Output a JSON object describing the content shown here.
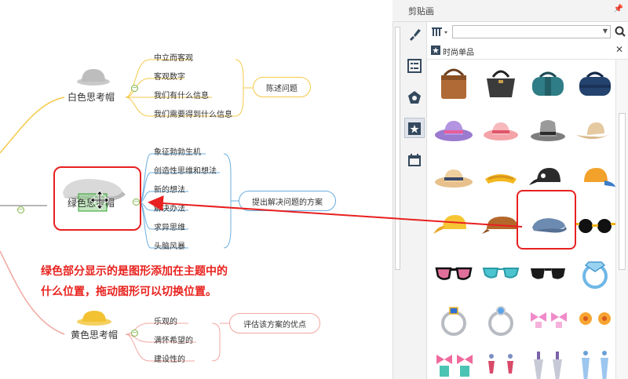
{
  "panel": {
    "title": "剪贴画",
    "pin_icon": "pin-icon",
    "category": "时尚单品",
    "search_placeholder": ""
  },
  "tabs": [
    "brush-icon",
    "list-icon",
    "pentagon-icon",
    "clipart-icon",
    "calendar-icon"
  ],
  "branches": [
    {
      "topic": "白色思考帽",
      "color": "#f5c94a",
      "items": [
        "中立而客观",
        "客观数字",
        "我们有什么信息",
        "我们需要得到什么信息"
      ],
      "summary": "陈述问题"
    },
    {
      "topic": "绿色思考帽",
      "color": "#6aaee0",
      "items": [
        "象征勃勃生机",
        "创造性思维和想法",
        "新的想法",
        "解决办法",
        "求异思维",
        "头脑风暴"
      ],
      "summary": "提出解决问题的方案"
    },
    {
      "topic": "黄色思考帽",
      "color": "#f2a7a0",
      "items": [
        "乐观的",
        "满怀希望的",
        "建设性的"
      ],
      "summary": "评估该方案的优点"
    }
  ],
  "annotation": {
    "line1": "绿色部分显示的是图形添加在主题中的",
    "line2": "什么位置，拖动图形可以切换位置。"
  },
  "clipart": [
    "tote-bag-brown",
    "handbag-black",
    "duffel-bag-teal",
    "duffel-bag-navy",
    "sun-hat-purple",
    "sun-hat-pink",
    "fedora-grey",
    "cowboy-hat-beige",
    "straw-hat",
    "visor-yellow",
    "cap-black",
    "cap-orange-blue",
    "cap-yellow",
    "cap-brown",
    "flat-cap-blue",
    "sunglasses-black",
    "sunglasses-pink",
    "sunglasses-teal",
    "sunglasses-aviator",
    "ring-blue-gem",
    "ring-silver-blue",
    "ring-silver-pink",
    "bow-earrings",
    "flower-earrings",
    "bow-earrings-teal",
    "drop-earrings",
    "chain-earrings",
    "tassel-earrings"
  ],
  "colors": {
    "highlight": "#e82020",
    "selection_bg": "#c5cad4",
    "annotation_text": "#e8231f"
  }
}
